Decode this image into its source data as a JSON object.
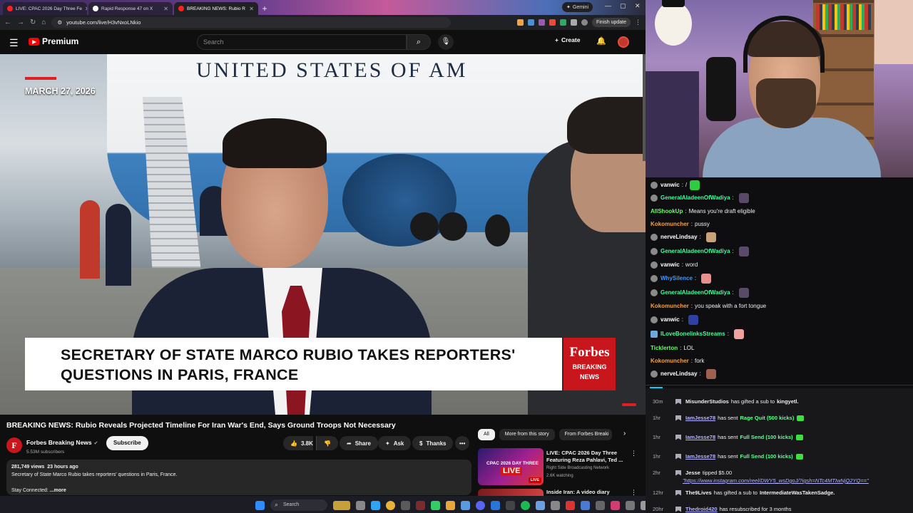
{
  "browser": {
    "tabs": [
      {
        "label": "LIVE: CPAC 2026 Day Three Fe",
        "favicon_color": "#ff2020"
      },
      {
        "label": "Rapid Response 47 on X",
        "favicon_color": "#ffffff"
      },
      {
        "label": "BREAKING NEWS: Rubio R",
        "favicon_color": "#ff2020"
      }
    ],
    "new_tab": "+",
    "gemini": "Gemini",
    "url": "youtube.com/live/H3vNxoLNkio",
    "finish_update": "Finish update"
  },
  "youtube": {
    "logo": "Premium",
    "search_placeholder": "Search",
    "create_label": "Create",
    "video": {
      "plane_text": "UNITED STATES OF AM",
      "date_overlay": "MARCH 27, 2026",
      "lower_third": [
        "SECRETARY OF STATE MARCO RUBIO TAKES REPORTERS'",
        "QUESTIONS IN PARIS, FRANCE"
      ],
      "brand": "Forbes",
      "brand_sub": [
        "BREAKING",
        "NEWS"
      ]
    },
    "title": "BREAKING NEWS: Rubio Reveals Projected Timeline For Iran War's End, Says Ground Troops Not Necessary",
    "channel": {
      "name": "Forbes Breaking News",
      "subscribers": "5.53M subscribers",
      "logo_letter": "F"
    },
    "subscribe": "Subscribe",
    "actions": {
      "likes": "3.8K",
      "share": "Share",
      "ask": "Ask",
      "thanks": "Thanks"
    },
    "description": {
      "views": "281,749 views",
      "age": "23 hours ago",
      "text": "Secretary of State Marco Rubio takes reporters' questions in Paris, France.",
      "stay": "Stay Connected:",
      "more": "...more"
    },
    "chips": [
      "All",
      "More from this story",
      "From Forbes Breaki"
    ],
    "recommendations": [
      {
        "title": "LIVE: CPAC 2026 Day Three Featuring Reza Pahlavi, Ted ...",
        "channel": "Right Side Broadcasting Network",
        "watching": "2.6K watching",
        "thumb_line1": "CPAC 2026 DAY THREE",
        "thumb_line2": "LIVE",
        "thumb_badge": "LIVE"
      },
      {
        "title": "Inside Iran: A video diary"
      }
    ]
  },
  "chat": {
    "messages": [
      {
        "user": "vanwic",
        "text": "/",
        "color": "#ffffff",
        "emote": "#2ecc40"
      },
      {
        "user": "GeneralAladeenOfWadiya",
        "text": "",
        "color": "#3cffa0",
        "emote": "#5a4a6a"
      },
      {
        "user": "AllShookUp",
        "text": "Means you're draft eligible",
        "color": "#66ff66",
        "emote": ""
      },
      {
        "user": "Kokomuncher",
        "text": "pussy",
        "color": "#ff9f2e",
        "emote": ""
      },
      {
        "user": "nerveLindsay",
        "text": "",
        "color": "#ffffff",
        "emote": "#c9a27a"
      },
      {
        "user": "GeneralAladeenOfWadiya",
        "text": "",
        "color": "#3cffa0",
        "emote": "#5a4a6a"
      },
      {
        "user": "vanwic",
        "text": "word",
        "color": "#ffffff",
        "emote": ""
      },
      {
        "user": "WhySilence",
        "text": "",
        "color": "#3b9cff",
        "emote": "#e89090"
      },
      {
        "user": "GeneralAladeenOfWadiya",
        "text": "",
        "color": "#3cffa0",
        "emote": "#5a4a6a"
      },
      {
        "user": "Kokomuncher",
        "text": "you speak with a fort tongue",
        "color": "#ff9f2e",
        "emote": ""
      },
      {
        "user": "vanwic",
        "text": "",
        "color": "#ffffff",
        "emote": "#3040a0"
      },
      {
        "user": "ILoveBonelinksStreams",
        "text": "",
        "color": "#3cffa0",
        "emote": "#f0a0a0"
      },
      {
        "user": "Ticklerton",
        "text": "LOL",
        "color": "#66ff66",
        "emote": ""
      },
      {
        "user": "Kokomuncher",
        "text": "fork",
        "color": "#ff9f2e",
        "emote": ""
      },
      {
        "user": "nerveLindsay",
        "text": "",
        "color": "#ffffff",
        "emote": "#a06050"
      }
    ]
  },
  "events": [
    {
      "time": "30m",
      "who": "MisunderStudios",
      "text": "has gifted a sub to",
      "target": "kingyetl."
    },
    {
      "time": "1hr",
      "who": "IamJesse78",
      "text": "has sent",
      "target": "Rage Quit (500 kicks)"
    },
    {
      "time": "1hr",
      "who": "IamJesse78",
      "text": "has sent",
      "target": "Full Send (100 kicks)"
    },
    {
      "time": "1hr",
      "who": "IamJesse78",
      "text": "has sent",
      "target": "Full Send (100 kicks)"
    },
    {
      "time": "2hr",
      "who": "Jesse",
      "text": "tipped $5.00",
      "target": "\"https://www.instagram.com/reel/DWY5_wsDgoJ/?igsh=NTc4MTIwNjQ2YQ==\""
    },
    {
      "time": "12hr",
      "who": "The9Lives",
      "text": "has gifted a sub to",
      "target": "IntermediateWasTakenSadge."
    },
    {
      "time": "20hr",
      "who": "Thedroid420",
      "text": "has resubscribed for 3 months",
      "target": ""
    }
  ],
  "taskbar": {
    "search": "Search"
  }
}
